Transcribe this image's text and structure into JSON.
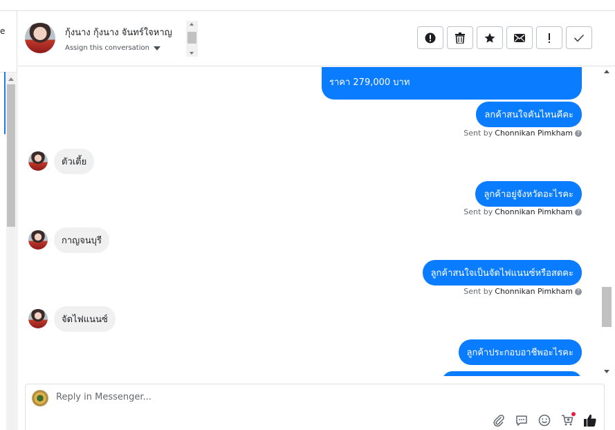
{
  "left_panel": {
    "cut_text": "e"
  },
  "header": {
    "contact_name": "กุ้งนาง กุ้งนาง จันทร์ใจหาญ",
    "assign_label": "Assign this conversation",
    "actions": [
      {
        "name": "mark-spam-button",
        "icon": "alert-circle-icon"
      },
      {
        "name": "delete-button",
        "icon": "trash-icon"
      },
      {
        "name": "star-button",
        "icon": "star-icon"
      },
      {
        "name": "mark-unread-button",
        "icon": "envelope-icon"
      },
      {
        "name": "follow-up-button",
        "icon": "exclamation-icon"
      },
      {
        "name": "mark-done-button",
        "icon": "check-icon"
      }
    ]
  },
  "messages": {
    "price": "ราคา 279,000 บาท",
    "m1_out": "ลกค้าสนใจคันไหนคีคะ",
    "m1_sent_prefix": "Sent by",
    "m1_sent_name": "Chonnikan Pimkham",
    "m2_in": "ตัวเตี้ย",
    "m3_out": "ลูกค้าอยู่จังหวัดอะไรคะ",
    "m3_sent_prefix": "Sent by",
    "m3_sent_name": "Chonnikan Pimkham",
    "m4_in": "กาญจนบุรี",
    "m5_out": "ลูกค้าสนใจเป็นจัดไฟแนนซ์หรือสดคะ",
    "m5_sent_prefix": "Sent by",
    "m5_sent_name": "Chonnikan Pimkham",
    "m6_in": "จัดไฟแนนซ์",
    "m7_out": "ลูกค้าประกอบอาชีพอะไรคะ",
    "help_glyph": "?"
  },
  "composer": {
    "placeholder": "Reply in Messenger...",
    "tools": [
      "paperclip-icon",
      "saved-reply-icon",
      "emoji-icon",
      "cart-icon",
      "thumbs-up-icon"
    ]
  },
  "colors": {
    "accent": "#0a7cff",
    "incoming": "#f0f0f0",
    "border": "#dddfe2"
  }
}
